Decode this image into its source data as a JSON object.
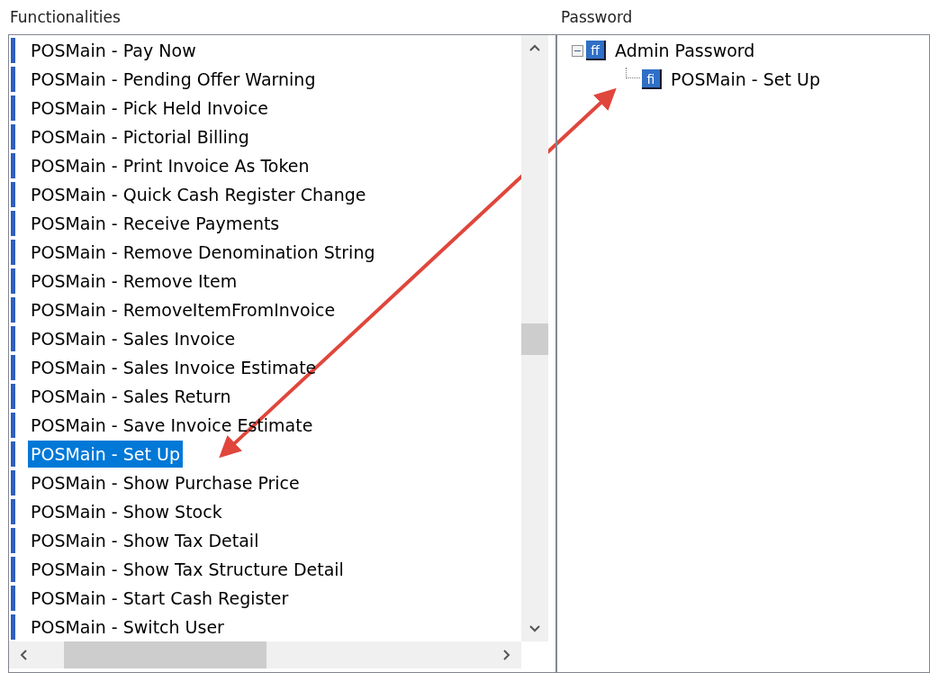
{
  "functionalities": {
    "title": "Functionalities",
    "items": [
      {
        "label": "POSMain - Pay Now",
        "selected": false
      },
      {
        "label": "POSMain - Pending Offer Warning",
        "selected": false
      },
      {
        "label": "POSMain - Pick Held Invoice",
        "selected": false
      },
      {
        "label": "POSMain - Pictorial Billing",
        "selected": false
      },
      {
        "label": "POSMain - Print Invoice As Token",
        "selected": false
      },
      {
        "label": "POSMain - Quick Cash Register Change",
        "selected": false
      },
      {
        "label": "POSMain - Receive Payments",
        "selected": false
      },
      {
        "label": "POSMain - Remove Denomination String",
        "selected": false
      },
      {
        "label": "POSMain - Remove Item",
        "selected": false
      },
      {
        "label": "POSMain - RemoveItemFromInvoice",
        "selected": false
      },
      {
        "label": "POSMain - Sales Invoice",
        "selected": false
      },
      {
        "label": "POSMain - Sales Invoice Estimate",
        "selected": false
      },
      {
        "label": "POSMain - Sales Return",
        "selected": false
      },
      {
        "label": "POSMain - Save Invoice Estimate",
        "selected": false
      },
      {
        "label": "POSMain - Set Up",
        "selected": true
      },
      {
        "label": "POSMain - Show Purchase Price",
        "selected": false
      },
      {
        "label": "POSMain - Show Stock",
        "selected": false
      },
      {
        "label": "POSMain - Show Tax Detail",
        "selected": false
      },
      {
        "label": "POSMain - Show Tax Structure Detail",
        "selected": false
      },
      {
        "label": "POSMain - Start Cash Register",
        "selected": false
      },
      {
        "label": "POSMain - Switch User",
        "selected": false
      }
    ]
  },
  "password": {
    "title": "Password",
    "tree": [
      {
        "badge": "ff",
        "label": "Admin Password",
        "expanded": true,
        "children": [
          {
            "badge": "fi",
            "label": "POSMain - Set Up"
          }
        ]
      }
    ]
  }
}
